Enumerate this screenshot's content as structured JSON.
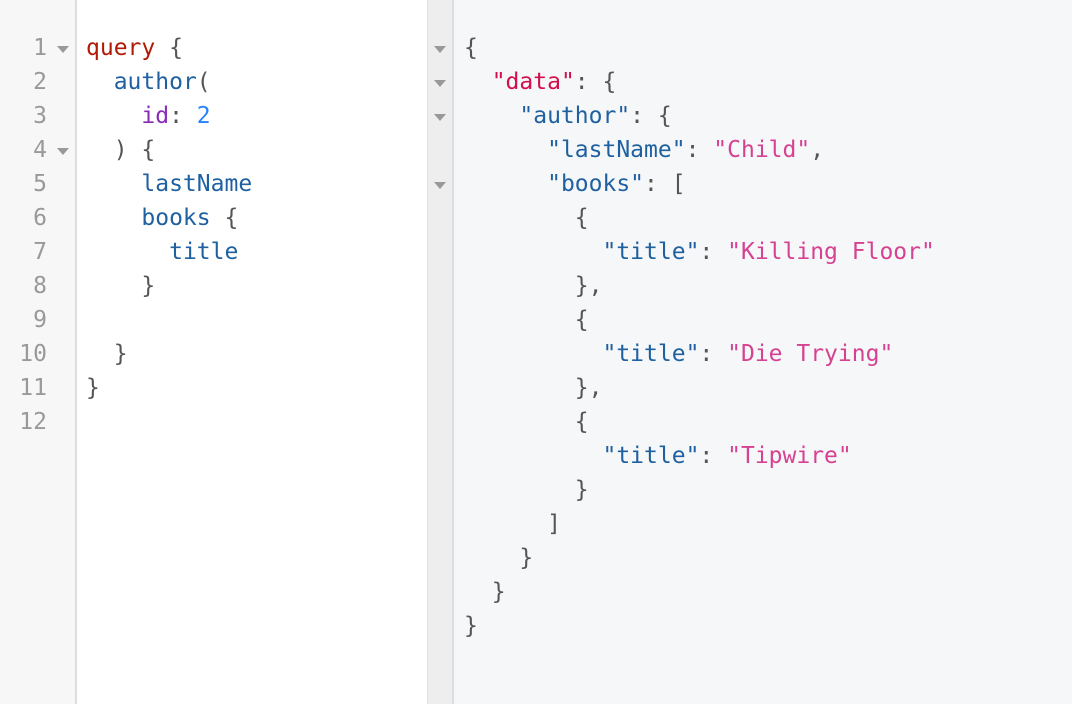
{
  "query_editor": {
    "line_numbers": [
      "1",
      "2",
      "3",
      "4",
      "5",
      "6",
      "7",
      "8",
      "9",
      "10",
      "11",
      "12"
    ],
    "fold_markers_on_lines": [
      1,
      4
    ],
    "lines": [
      {
        "indent": "",
        "tokens": [
          {
            "t": "kw",
            "v": "query"
          },
          {
            "t": "punct",
            "v": " {"
          }
        ]
      },
      {
        "indent": "  ",
        "tokens": [
          {
            "t": "field",
            "v": "author"
          },
          {
            "t": "punct",
            "v": "("
          }
        ]
      },
      {
        "indent": "    ",
        "tokens": [
          {
            "t": "arg",
            "v": "id"
          },
          {
            "t": "punct",
            "v": ": "
          },
          {
            "t": "num",
            "v": "2"
          }
        ]
      },
      {
        "indent": "  ",
        "tokens": [
          {
            "t": "punct",
            "v": ") {"
          }
        ]
      },
      {
        "indent": "    ",
        "tokens": [
          {
            "t": "field",
            "v": "lastName"
          }
        ]
      },
      {
        "indent": "    ",
        "tokens": [
          {
            "t": "field",
            "v": "books"
          },
          {
            "t": "punct",
            "v": " {"
          }
        ]
      },
      {
        "indent": "      ",
        "tokens": [
          {
            "t": "field",
            "v": "title"
          }
        ]
      },
      {
        "indent": "    ",
        "tokens": [
          {
            "t": "punct",
            "v": "}"
          }
        ]
      },
      {
        "indent": "",
        "tokens": []
      },
      {
        "indent": "  ",
        "tokens": [
          {
            "t": "punct",
            "v": "}"
          }
        ]
      },
      {
        "indent": "",
        "tokens": [
          {
            "t": "punct",
            "v": "}"
          }
        ]
      },
      {
        "indent": "",
        "tokens": []
      }
    ]
  },
  "result_viewer": {
    "fold_markers_on_lines": [
      1,
      2,
      3,
      5
    ],
    "lines": [
      {
        "indent": "",
        "tokens": [
          {
            "t": "punct",
            "v": "{"
          }
        ]
      },
      {
        "indent": "  ",
        "tokens": [
          {
            "t": "jkey-data",
            "v": "\"data\""
          },
          {
            "t": "punct",
            "v": ": {"
          }
        ]
      },
      {
        "indent": "    ",
        "tokens": [
          {
            "t": "jkey",
            "v": "\"author\""
          },
          {
            "t": "punct",
            "v": ": {"
          }
        ]
      },
      {
        "indent": "      ",
        "tokens": [
          {
            "t": "jkey",
            "v": "\"lastName\""
          },
          {
            "t": "punct",
            "v": ": "
          },
          {
            "t": "jstr",
            "v": "\"Child\""
          },
          {
            "t": "punct",
            "v": ","
          }
        ]
      },
      {
        "indent": "      ",
        "tokens": [
          {
            "t": "jkey",
            "v": "\"books\""
          },
          {
            "t": "punct",
            "v": ": ["
          }
        ]
      },
      {
        "indent": "        ",
        "tokens": [
          {
            "t": "punct",
            "v": "{"
          }
        ]
      },
      {
        "indent": "          ",
        "tokens": [
          {
            "t": "jkey",
            "v": "\"title\""
          },
          {
            "t": "punct",
            "v": ": "
          },
          {
            "t": "jstr",
            "v": "\"Killing Floor\""
          }
        ]
      },
      {
        "indent": "        ",
        "tokens": [
          {
            "t": "punct",
            "v": "},"
          }
        ]
      },
      {
        "indent": "        ",
        "tokens": [
          {
            "t": "punct",
            "v": "{"
          }
        ]
      },
      {
        "indent": "          ",
        "tokens": [
          {
            "t": "jkey",
            "v": "\"title\""
          },
          {
            "t": "punct",
            "v": ": "
          },
          {
            "t": "jstr",
            "v": "\"Die Trying\""
          }
        ]
      },
      {
        "indent": "        ",
        "tokens": [
          {
            "t": "punct",
            "v": "},"
          }
        ]
      },
      {
        "indent": "        ",
        "tokens": [
          {
            "t": "punct",
            "v": "{"
          }
        ]
      },
      {
        "indent": "          ",
        "tokens": [
          {
            "t": "jkey",
            "v": "\"title\""
          },
          {
            "t": "punct",
            "v": ": "
          },
          {
            "t": "jstr",
            "v": "\"Tipwire\""
          }
        ]
      },
      {
        "indent": "        ",
        "tokens": [
          {
            "t": "punct",
            "v": "}"
          }
        ]
      },
      {
        "indent": "      ",
        "tokens": [
          {
            "t": "punct",
            "v": "]"
          }
        ]
      },
      {
        "indent": "    ",
        "tokens": [
          {
            "t": "punct",
            "v": "}"
          }
        ]
      },
      {
        "indent": "  ",
        "tokens": [
          {
            "t": "punct",
            "v": "}"
          }
        ]
      },
      {
        "indent": "",
        "tokens": [
          {
            "t": "punct",
            "v": "}"
          }
        ]
      }
    ]
  },
  "colors": {
    "keyword": "#b11a04",
    "field": "#1f61a0",
    "argument": "#8b2bb9",
    "number": "#2882f9",
    "punctuation": "#555555",
    "json_key": "#1f61a0",
    "json_data_key": "#d0104c",
    "json_string": "#d64292",
    "line_number": "#999999"
  }
}
